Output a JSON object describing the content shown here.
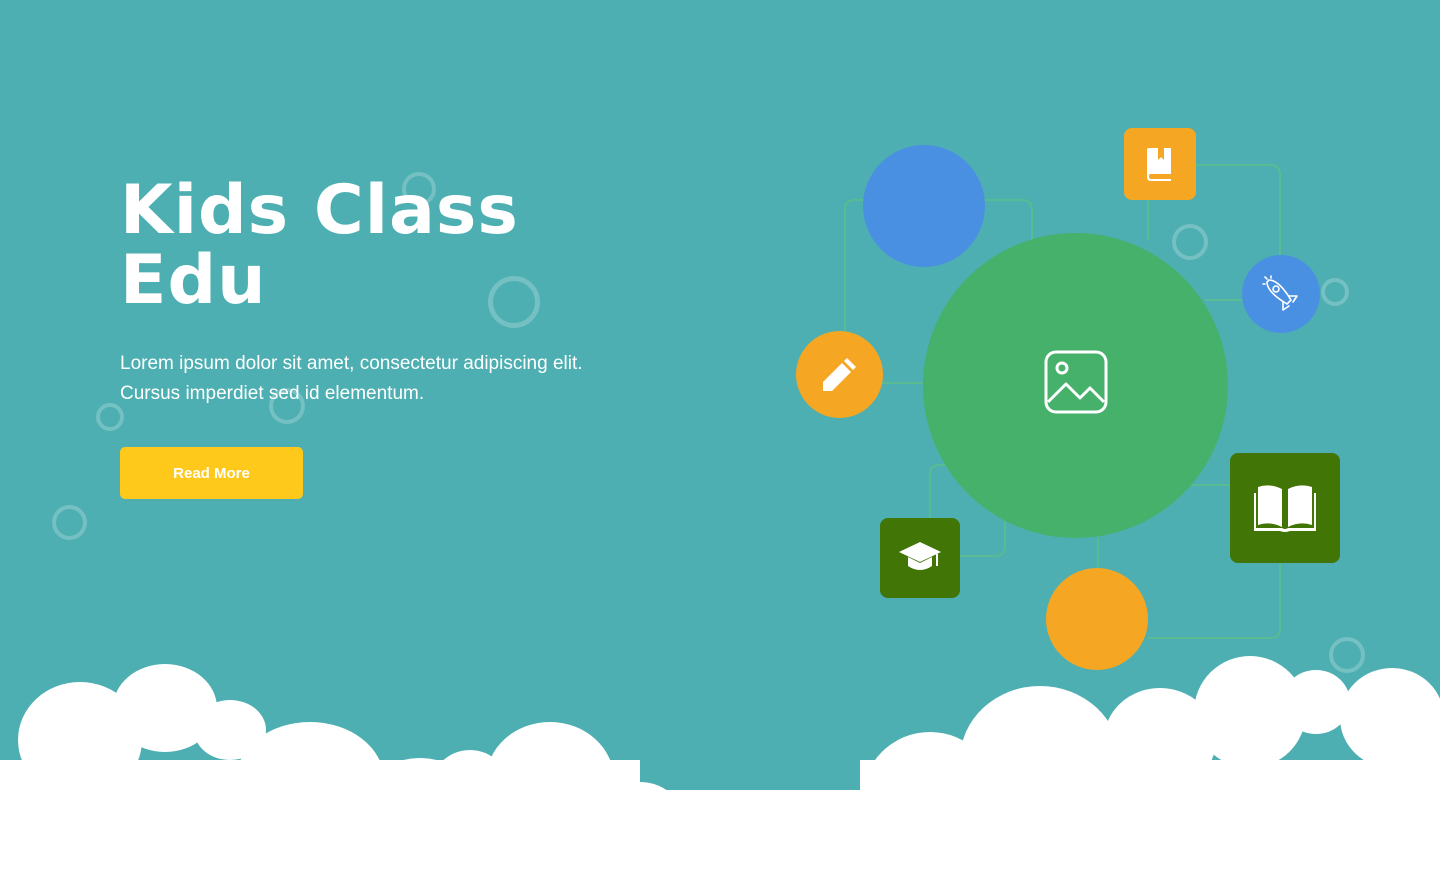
{
  "hero": {
    "title_line1": "Kids Class",
    "title_line2": "Edu",
    "description_line1": "Lorem ipsum dolor sit amet, consectetur adipiscing elit.",
    "description_line2": "Cursus imperdiet sed id elementum.",
    "cta_label": "Read More"
  },
  "colors": {
    "background": "#4DAFB1",
    "cta": "#FFC91C",
    "blue": "#4A90E2",
    "orange": "#F5A623",
    "green": "#46B16B",
    "dark_green": "#417505",
    "white": "#FFFFFF"
  },
  "illustration": {
    "icons": [
      "image-icon",
      "bookmark-book-icon",
      "rocket-icon",
      "pencil-icon",
      "open-book-icon",
      "graduation-cap-icon"
    ]
  }
}
